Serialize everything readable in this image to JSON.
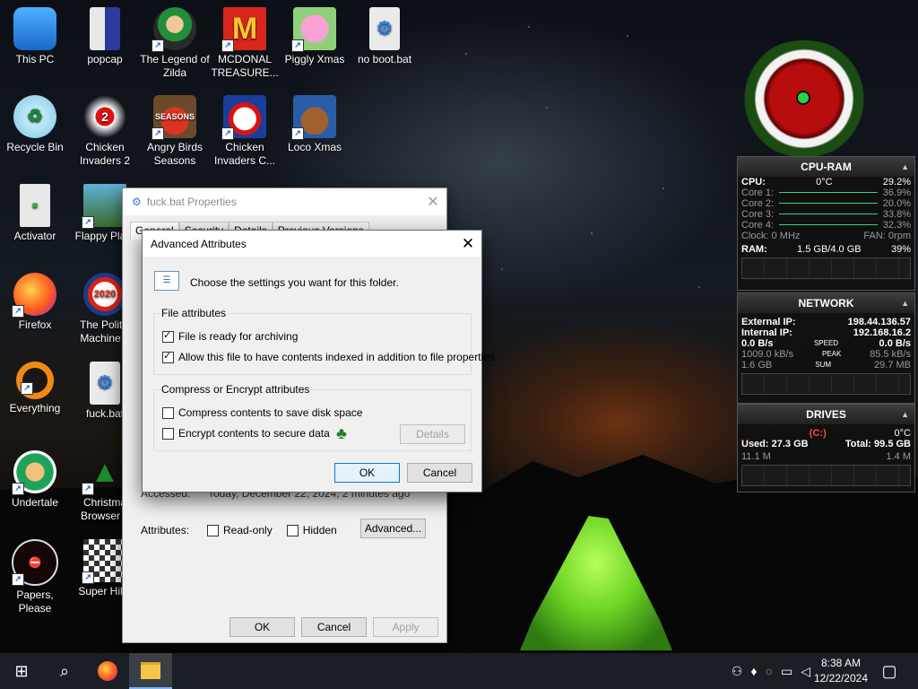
{
  "desktop": {
    "icons": [
      {
        "label": "This PC",
        "icon": "computer-icon"
      },
      {
        "label": "Recycle Bin",
        "icon": "recycle-bin-icon"
      },
      {
        "label": "Activator",
        "icon": "file-icon"
      },
      {
        "label": "Firefox",
        "icon": "firefox-icon"
      },
      {
        "label": "Everything",
        "icon": "search-ring-icon"
      },
      {
        "label": "Undertale",
        "icon": "undertale-icon"
      },
      {
        "label": "Papers, Please",
        "icon": "papers-please-icon"
      },
      {
        "label": "popcap",
        "icon": "popcap-icon"
      },
      {
        "label": "Chicken Invaders 2",
        "icon": "chicken-icon"
      },
      {
        "label": "Flappy Pla...",
        "icon": "flappy-icon"
      },
      {
        "label": "The Politic Machine 2",
        "icon": "politic-icon"
      },
      {
        "label": "fuck.bat",
        "icon": "bat-file-icon"
      },
      {
        "label": "Christma Browser 9",
        "icon": "tree-icon"
      },
      {
        "label": "Super Hil...",
        "icon": "pixel-game-icon"
      },
      {
        "label": "The Legend of Zilda",
        "icon": "zelda-icon"
      },
      {
        "label": "Angry Birds Seasons",
        "icon": "angry-birds-icon"
      },
      {
        "label": "MCDONAL TREASURE...",
        "icon": "mcdonalds-icon"
      },
      {
        "label": "Chicken Invaders C...",
        "icon": "snowman-icon"
      },
      {
        "label": "Piggly Xmas",
        "icon": "pig-icon"
      },
      {
        "label": "Loco Xmas",
        "icon": "bear-icon"
      },
      {
        "label": "no boot.bat",
        "icon": "bat-file-icon"
      }
    ]
  },
  "properties": {
    "title": "fuck.bat Properties",
    "tabs": [
      "General",
      "Security",
      "Details",
      "Previous Versions"
    ],
    "accessed_label": "Accessed:",
    "accessed_value": "Today, December 22, 2024, 2 minutes ago",
    "attributes_label": "Attributes:",
    "readonly_label": "Read-only",
    "hidden_label": "Hidden",
    "advanced_label": "Advanced...",
    "ok_label": "OK",
    "cancel_label": "Cancel",
    "apply_label": "Apply"
  },
  "advanced": {
    "title": "Advanced Attributes",
    "description": "Choose the settings you want for this folder.",
    "file_group": "File attributes",
    "archive_label": "File is ready for archiving",
    "index_label": "Allow this file to have contents indexed in addition to file properties",
    "compress_group": "Compress or Encrypt attributes",
    "compress_label": "Compress contents to save disk space",
    "encrypt_label": "Encrypt contents to secure data",
    "details_label": "Details",
    "ok_label": "OK",
    "cancel_label": "Cancel"
  },
  "cpu_ram": {
    "title": "CPU-RAM",
    "temp": "0°C",
    "cpu_label": "CPU:",
    "cpu_value": "29.2%",
    "cores": [
      {
        "label": "Core 1:",
        "value": "36.9%"
      },
      {
        "label": "Core 2:",
        "value": "20.0%"
      },
      {
        "label": "Core 3:",
        "value": "33.8%"
      },
      {
        "label": "Core 4:",
        "value": "32.3%"
      }
    ],
    "clock": "Clock: 0 MHz",
    "fan": "FAN: 0rpm",
    "ram_label": "RAM:",
    "ram_value": "1.5 GB/4.0 GB",
    "ram_pct": "39%"
  },
  "network": {
    "title": "NETWORK",
    "external_label": "External IP:",
    "external_ip": "198.44.136.57",
    "internal_label": "Internal IP:",
    "internal_ip": "192.168.16.2",
    "down_speed": "0.0 B/s",
    "speed_label": "SPEED",
    "up_speed": "0.0 B/s",
    "down_peak": "1009.0 kB/s",
    "peak_label": "PEAK",
    "up_peak": "85.5 kB/s",
    "down_sum": "1.6 GB",
    "sum_label": "SUM",
    "up_sum": "29.7 MB"
  },
  "drives": {
    "title": "DRIVES",
    "drive": "(C:)",
    "temp": "0°C",
    "used": "Used: 27.3 GB",
    "total": "Total: 99.5 GB",
    "read": "11.1 M",
    "write": "1.4 M"
  },
  "taskbar": {
    "time": "8:38 AM",
    "date": "12/22/2024"
  }
}
